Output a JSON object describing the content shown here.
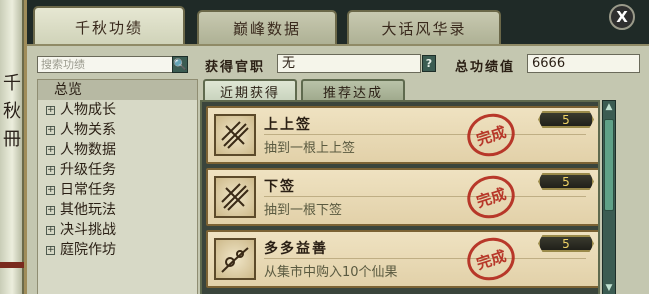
{
  "side_scroll": {
    "chars": [
      "千",
      "秋",
      "冊"
    ]
  },
  "tabs": [
    {
      "label": "千秋功绩",
      "active": true
    },
    {
      "label": "巅峰数据",
      "active": false
    },
    {
      "label": "大话风华录",
      "active": false
    }
  ],
  "close_label": "X",
  "search": {
    "placeholder": "搜索功绩",
    "icon": "search-icon"
  },
  "categories": [
    {
      "label": "总览",
      "expandable": false,
      "selected": true
    },
    {
      "label": "人物成长",
      "expandable": true
    },
    {
      "label": "人物关系",
      "expandable": true
    },
    {
      "label": "人物数据",
      "expandable": true
    },
    {
      "label": "升级任务",
      "expandable": true
    },
    {
      "label": "日常任务",
      "expandable": true
    },
    {
      "label": "其他玩法",
      "expandable": true
    },
    {
      "label": "决斗挑战",
      "expandable": true
    },
    {
      "label": "庭院作坊",
      "expandable": true
    }
  ],
  "header": {
    "title_label": "获得官职",
    "title_value": "无",
    "help_label": "?",
    "score_label": "总功绩值",
    "score_value": "6666"
  },
  "subtabs": [
    {
      "label": "近期获得",
      "active": true
    },
    {
      "label": "推荐达成",
      "active": false
    }
  ],
  "achievements": [
    {
      "title": "上上签",
      "desc": "抽到一根上上签",
      "stamp": "完成",
      "points": "5"
    },
    {
      "title": "下签",
      "desc": "抽到一根下签",
      "stamp": "完成",
      "points": "5"
    },
    {
      "title": "多多益善",
      "desc": "从集市中购入10个仙果",
      "stamp": "完成",
      "points": "5"
    }
  ],
  "colors": {
    "stamp_red": "#b42a1e",
    "panel_bg": "#c4c7b0",
    "scroll_green": "#3b5c52",
    "points_gold": "#f0d466"
  }
}
